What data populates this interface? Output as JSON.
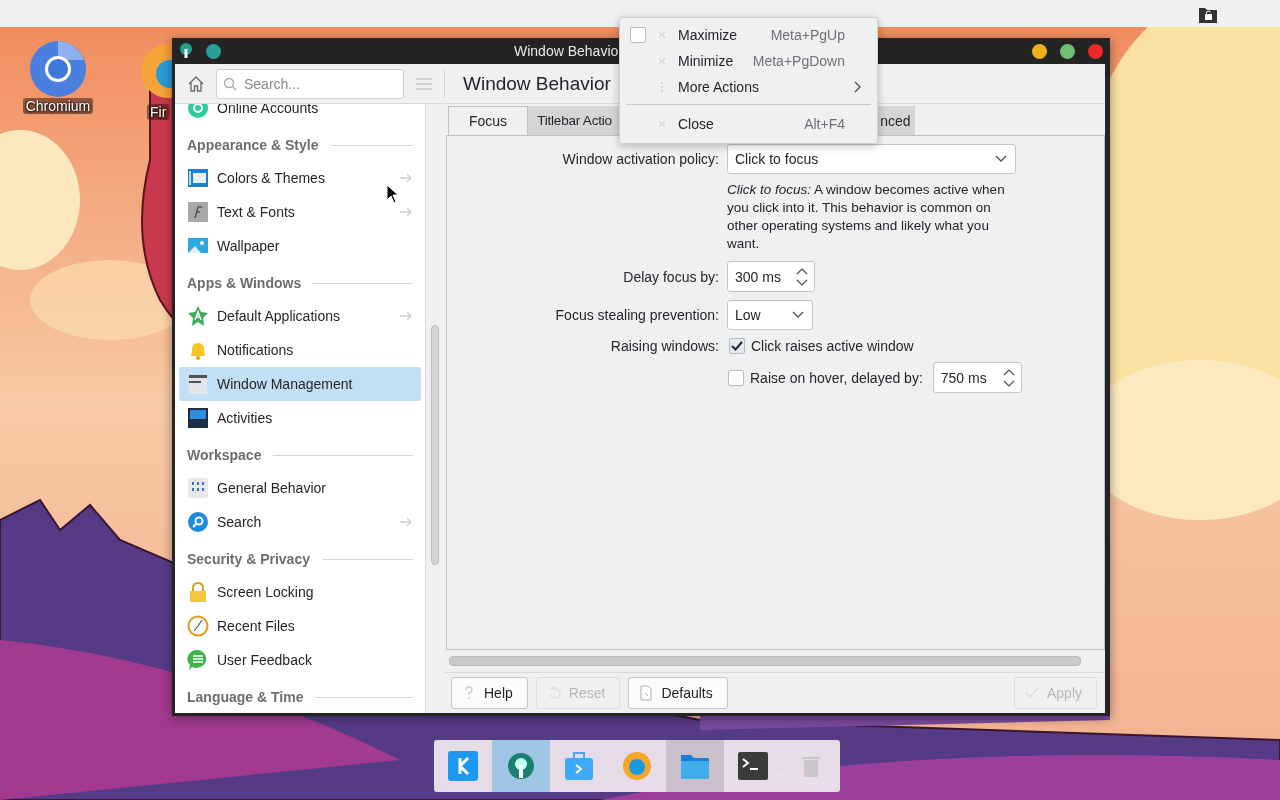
{
  "desktop_icons": [
    {
      "label": "Chromium"
    },
    {
      "label": "Fir"
    }
  ],
  "window": {
    "title": "Window Behavio",
    "page_title": "Window Behavior",
    "search": {
      "placeholder": "Search..."
    }
  },
  "sidebar": {
    "items": [
      {
        "kind": "item",
        "label": "Online Accounts",
        "arrow": false,
        "selected": false
      },
      {
        "kind": "header",
        "label": "Appearance & Style"
      },
      {
        "kind": "item",
        "label": "Colors & Themes",
        "arrow": true,
        "selected": false
      },
      {
        "kind": "item",
        "label": "Text & Fonts",
        "arrow": true,
        "selected": false
      },
      {
        "kind": "item",
        "label": "Wallpaper",
        "arrow": false,
        "selected": false
      },
      {
        "kind": "header",
        "label": "Apps & Windows"
      },
      {
        "kind": "item",
        "label": "Default Applications",
        "arrow": true,
        "selected": false
      },
      {
        "kind": "item",
        "label": "Notifications",
        "arrow": false,
        "selected": false
      },
      {
        "kind": "item",
        "label": "Window Management",
        "arrow": false,
        "selected": true
      },
      {
        "kind": "item",
        "label": "Activities",
        "arrow": false,
        "selected": false
      },
      {
        "kind": "header",
        "label": "Workspace"
      },
      {
        "kind": "item",
        "label": "General Behavior",
        "arrow": false,
        "selected": false
      },
      {
        "kind": "item",
        "label": "Search",
        "arrow": true,
        "selected": false
      },
      {
        "kind": "header",
        "label": "Security & Privacy"
      },
      {
        "kind": "item",
        "label": "Screen Locking",
        "arrow": false,
        "selected": false
      },
      {
        "kind": "item",
        "label": "Recent Files",
        "arrow": false,
        "selected": false
      },
      {
        "kind": "item",
        "label": "User Feedback",
        "arrow": false,
        "selected": false
      },
      {
        "kind": "header",
        "label": "Language & Time"
      }
    ]
  },
  "tabs": [
    {
      "label": "Focus",
      "selected": true
    },
    {
      "label": "Titlebar Actio",
      "selected": false
    },
    {
      "label": "nced",
      "selected": false
    }
  ],
  "form": {
    "activation_label": "Window activation policy:",
    "activation_value": "Click to focus",
    "activation_description": "*Click to focus:* A window becomes active when you click into it. This behavior is common on other operating systems and likely what you want.",
    "delay_label": "Delay focus by:",
    "delay_value": "300 ms",
    "stealing_label": "Focus stealing prevention:",
    "stealing_value": "Low",
    "raising_label": "Raising windows:",
    "click_raises": {
      "label": "Click raises active window",
      "checked": true
    },
    "raise_on_hover": {
      "label": "Raise on hover, delayed by:",
      "checked": false,
      "value": "750 ms"
    }
  },
  "buttons": [
    {
      "label": "Help",
      "disabled": false
    },
    {
      "label": "Reset",
      "disabled": true
    },
    {
      "label": "Defaults",
      "disabled": false
    },
    {
      "label": "Apply",
      "disabled": true
    }
  ],
  "context_menu": {
    "items": [
      {
        "kind": "action",
        "label": "Maximize",
        "shortcut": "Meta+PgUp",
        "checked": false
      },
      {
        "kind": "action",
        "label": "Minimize",
        "shortcut": "Meta+PgDown"
      },
      {
        "kind": "submenu",
        "label": "More Actions"
      },
      {
        "kind": "separator"
      },
      {
        "kind": "action",
        "label": "Close",
        "shortcut": "Alt+F4"
      }
    ]
  },
  "dock": {
    "items": [
      {
        "selected": false,
        "running": false
      },
      {
        "selected": true,
        "running": false
      },
      {
        "selected": false,
        "running": false
      },
      {
        "selected": false,
        "running": false
      },
      {
        "selected": false,
        "running": true
      },
      {
        "selected": false,
        "running": false
      },
      {
        "selected": false,
        "running": false
      }
    ]
  }
}
